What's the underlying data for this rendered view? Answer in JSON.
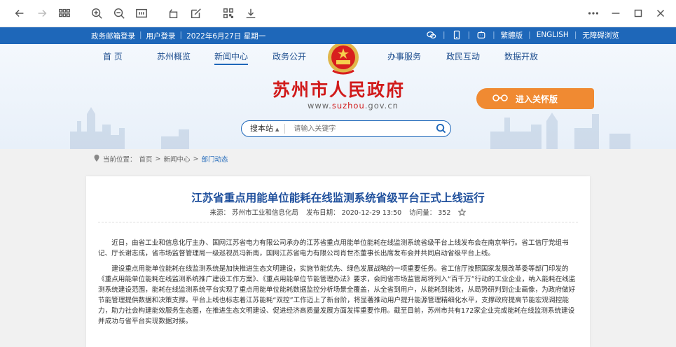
{
  "browser": {
    "buttons": [
      "back",
      "forward",
      "apps",
      "zoom-in",
      "zoom-out",
      "reader",
      "rotate",
      "edit",
      "qr",
      "download",
      "more",
      "minimize",
      "maximize",
      "close"
    ]
  },
  "topbar": {
    "links": [
      "政务邮箱登录",
      "用户登录"
    ],
    "date": "2022年6月27日 星期一",
    "right_links": [
      "繁體版",
      "ENGLISH",
      "无障碍浏览"
    ]
  },
  "nav": {
    "items": [
      "首 页",
      "苏州概览",
      "新闻中心",
      "政务公开",
      "办事服务",
      "政民互动",
      "数据开放"
    ],
    "active": "新闻中心"
  },
  "site": {
    "title": "苏州市人民政府",
    "domain_prefix": "www.",
    "domain_mid": "suzhou",
    "domain_suffix": ".gov.cn",
    "care_label": "进入关怀版"
  },
  "search": {
    "scope": "搜本站",
    "placeholder": "请输入关键字"
  },
  "breadcrumb": {
    "label": "当前位置：",
    "items": [
      "首页",
      "新闻中心",
      "部门动态"
    ],
    "sep": ">"
  },
  "article": {
    "title": "江苏省重点用能单位能耗在线监测系统省级平台正式上线运行",
    "source": "来源：  苏州市工业和信息化局",
    "date": "发布日期：  2020-12-29 13:50",
    "views": "访问量：  352",
    "p1": "近日，由省工业和信息化厅主办、国网江苏省电力有限公司承办的江苏省重点用能单位能耗在线监测系统省级平台上线发布会在南京举行。省工信厅党组书记、厅长谢志成，省市场监督管理局一级巡视员冯新南，国网江苏省电力有限公司肖世杰董事长出席发布会并共同启动省级平台上线。",
    "p2": "建设重点用能单位能耗在线监测系统是加快推进生态文明建设，实施节能优先、绿色发展战略的一项重要任务。省工信厅按照国家发展改革委等部门印发的《重点用能单位能耗在线监测系统推广建设工作方案》、《重点用能单位节能管理办法》要求，会同省市场监管局将列入“百千万”行动的工业企业，纳入能耗在线监测系统建设范围，能耗在线监测系统平台实现了重点用能单位能耗数据监控分析场景全覆盖，从全省到用户，从能耗到能效，从局势研判到企业画像，为政府做好节能管理提供数据和决策支撑。平台上线也标志着江苏能耗“双控”工作迈上了新台阶，将显著推动用户提升能源管理精细化水平，支撑政府提高节能宏观调控能力，助力社会构建能效服务生态圈，在推进生态文明建设、促进经济高质量发展方面发挥重要作用。截至目前，苏州市共有172家企业完成能耗在线监测系统建设并成功与省平台实现数据对接。"
  }
}
